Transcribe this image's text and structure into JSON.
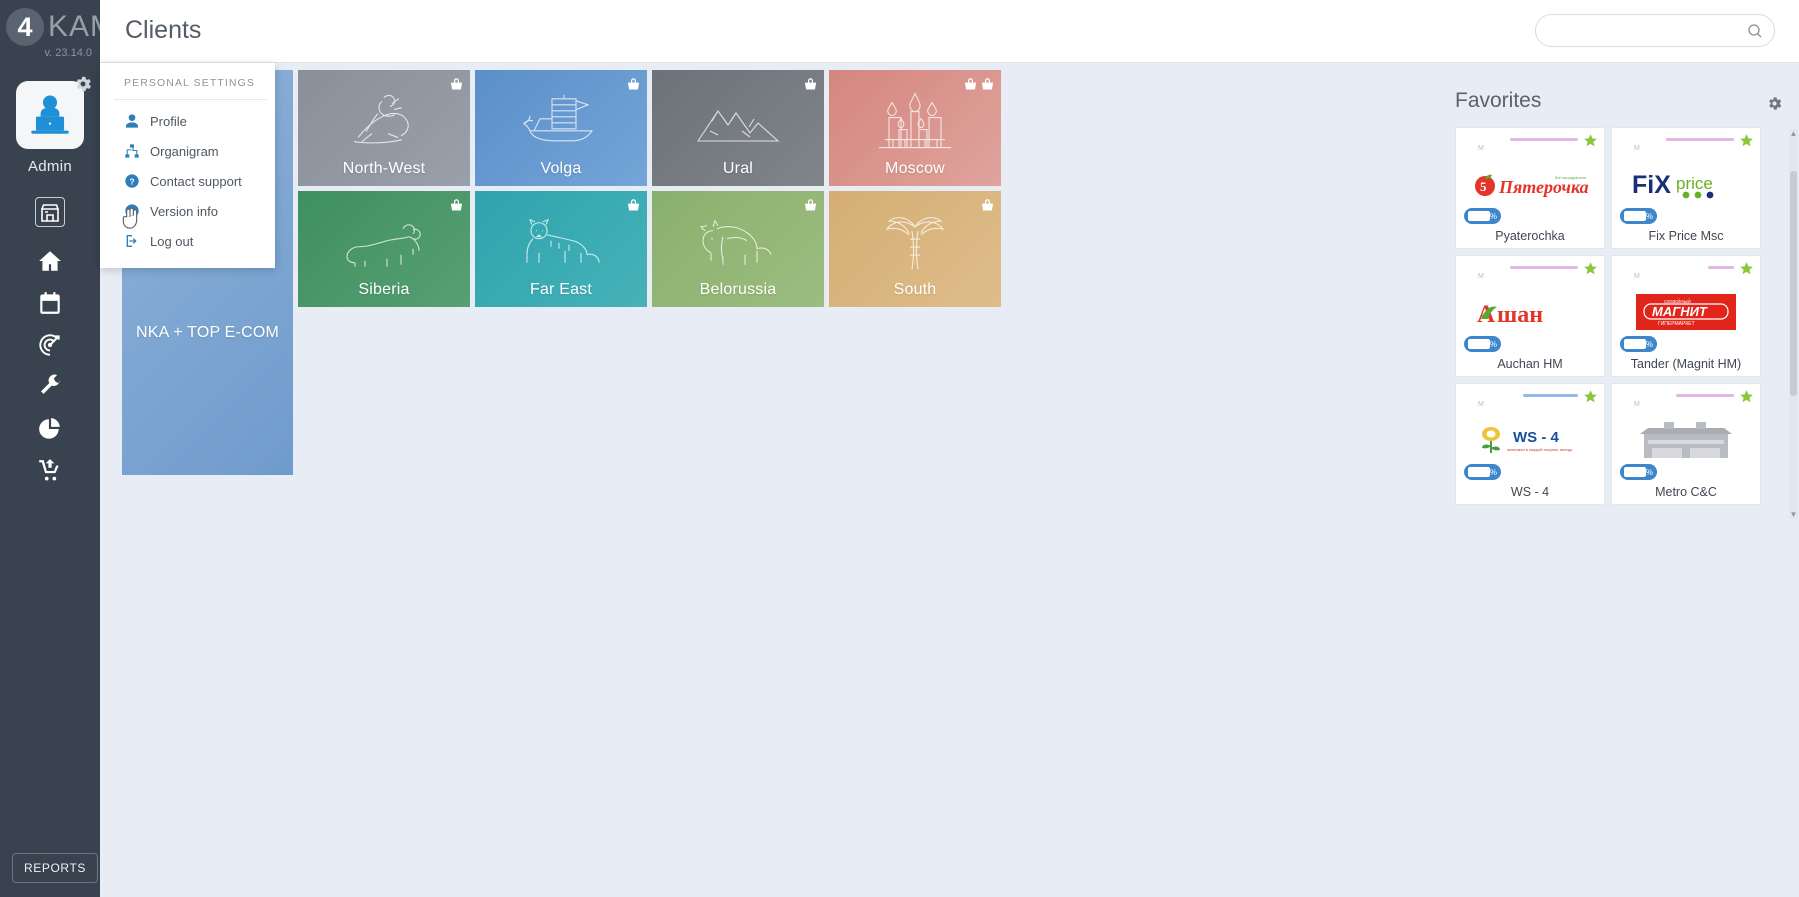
{
  "brand": {
    "logo_char": "4",
    "name": "KAM",
    "version": "v. 23.14.0"
  },
  "sidebar": {
    "user_name": "Admin",
    "avatar_icon": "user-laptop-icon",
    "gear_icon": "gear-icon",
    "reports_label": "REPORTS",
    "items": [
      {
        "icon": "store-icon",
        "name": "sidebar-item-store"
      },
      {
        "icon": "home-icon",
        "name": "sidebar-item-home"
      },
      {
        "icon": "calendar-check-icon",
        "name": "sidebar-item-calendar"
      },
      {
        "icon": "target-icon",
        "name": "sidebar-item-target"
      },
      {
        "icon": "wrench-icon",
        "name": "sidebar-item-tools"
      },
      {
        "icon": "pie-chart-icon",
        "name": "sidebar-item-analytics"
      },
      {
        "icon": "cart-upload-icon",
        "name": "sidebar-item-cart"
      }
    ]
  },
  "topbar": {
    "title": "Clients",
    "search_value": "",
    "search_placeholder": "",
    "search_icon": "search-icon"
  },
  "menu": {
    "header": "PERSONAL SETTINGS",
    "items": [
      {
        "label": "Profile",
        "icon": "user-icon"
      },
      {
        "label": "Organigram",
        "icon": "org-chart-icon"
      },
      {
        "label": "Contact support",
        "icon": "question-circle-icon"
      },
      {
        "label": "Version info",
        "icon": "info-circle-icon"
      },
      {
        "label": "Log out",
        "icon": "logout-icon"
      }
    ]
  },
  "tiles": {
    "wide": {
      "label": "NKA + TOP E-COM",
      "color_from": "#8fb3d9",
      "color_to": "#6f9bcc",
      "emblem": "coat-of-arms-icon",
      "badges": []
    },
    "grid": [
      {
        "label": "North-West",
        "color_from": "#8a8f99",
        "color_to": "#9aa0aa",
        "emblem": "bronze-horseman-icon",
        "badges": [
          "basket-icon"
        ]
      },
      {
        "label": "Volga",
        "color_from": "#5b8fc9",
        "color_to": "#6fa2d6",
        "emblem": "ship-icon",
        "badges": [
          "basket-icon"
        ]
      },
      {
        "label": "Ural",
        "color_from": "#6d7278",
        "color_to": "#7d8288",
        "emblem": "mountains-icon",
        "badges": [
          "basket-icon"
        ]
      },
      {
        "label": "Moscow",
        "color_from": "#d98b86",
        "color_to": "#dd9a93",
        "emblem": "st-basil-icon",
        "badges": [
          "basket-icon",
          "basket-icon"
        ]
      },
      {
        "label": "Siberia",
        "color_from": "#3f8f5f",
        "color_to": "#4e9d6c",
        "emblem": "bear-icon",
        "badges": [
          "basket-icon"
        ]
      },
      {
        "label": "Far East",
        "color_from": "#2fa3ad",
        "color_to": "#3cb0b6",
        "emblem": "tiger-icon",
        "badges": [
          "basket-icon"
        ]
      },
      {
        "label": "Belorussia",
        "color_from": "#8ab06d",
        "color_to": "#96ba79",
        "emblem": "bison-icon",
        "badges": [
          "basket-icon"
        ]
      },
      {
        "label": "South",
        "color_from": "#d7b277",
        "color_to": "#dcba83",
        "emblem": "palm-icon",
        "badges": [
          "basket-icon"
        ]
      }
    ]
  },
  "favorites": {
    "title": "Favorites",
    "gear_icon": "gear-icon",
    "star_icon": "star-icon",
    "star_color": "#8cc63f",
    "discount_badge_icon": "truck-percent-icon",
    "cards": [
      {
        "name": "Pyaterochka",
        "logo": "pyaterochka-logo",
        "mini_bar_color": "#d07ad0",
        "mini_text": "M"
      },
      {
        "name": "Fix Price Msc",
        "logo": "fixprice-logo",
        "mini_bar_color": "#d07ad0",
        "mini_text": "M"
      },
      {
        "name": "Auchan HM",
        "logo": "auchan-logo",
        "mini_bar_color": "#d07ad0",
        "mini_text": "M"
      },
      {
        "name": "Tander (Magnit HM)",
        "logo": "magnit-logo",
        "mini_bar_color": "#d07ad0",
        "mini_text": "M"
      },
      {
        "name": "WS - 4",
        "logo": "ws4-logo",
        "mini_bar_color": "#3a7fd5",
        "mini_text": "M"
      },
      {
        "name": "Metro C&C",
        "logo": "metro-logo",
        "mini_bar_color": "#3a7fd5",
        "mini_text": "M"
      }
    ]
  }
}
